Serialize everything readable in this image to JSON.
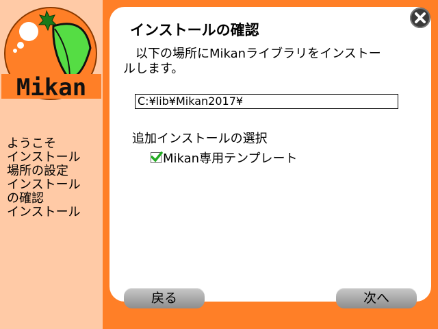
{
  "logo": {
    "text": "Mikan"
  },
  "sidebar": {
    "steps": [
      {
        "label": "ようこそ"
      },
      {
        "label": "インストール"
      },
      {
        "label": "場所の設定"
      },
      {
        "label": "インストール"
      },
      {
        "label": "の確認"
      },
      {
        "label": "インストール"
      }
    ]
  },
  "dialog": {
    "title": "インストールの確認",
    "description": "　以下の場所にMikanライブラリをインストールします。",
    "install_path": "C:¥lib¥Mikan2017¥",
    "options_heading": "追加インストールの選択",
    "options": [
      {
        "label": "Mikan専用テンプレート",
        "checked": true
      }
    ]
  },
  "buttons": {
    "back": "戻る",
    "next": "次へ"
  },
  "colors": {
    "accent": "#ff7f27",
    "sidebar": "#ffcaa6",
    "check": "#22aa22"
  }
}
